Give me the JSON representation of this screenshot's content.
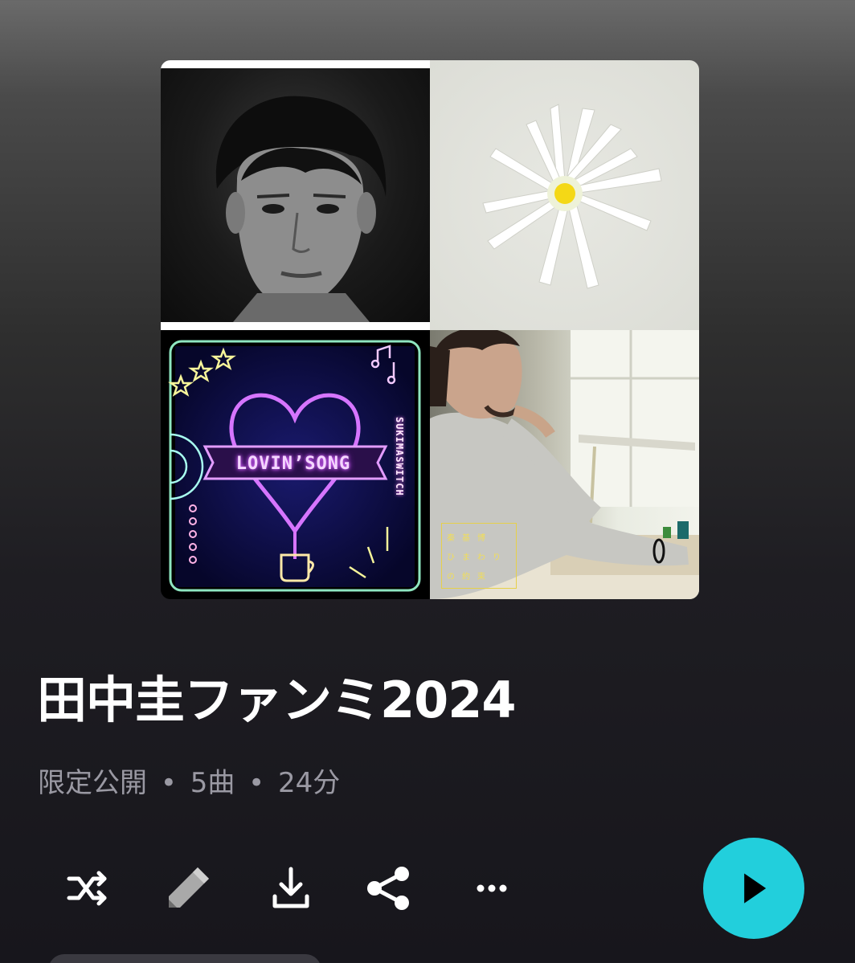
{
  "playlist": {
    "title": "田中圭ファンミ2024",
    "visibility": "限定公開",
    "separator": "•",
    "track_count": "5曲",
    "duration": "24分"
  },
  "artwork": {
    "tile3": {
      "title": "LOVIN’SONG",
      "artist": "SUKIMASWITCH"
    },
    "tile4": {
      "lines": [
        "秦基博",
        "ひまわり",
        "の約束"
      ]
    }
  },
  "actions": {
    "shuffle": "shuffle-icon",
    "edit": "pencil-icon",
    "download": "download-icon",
    "share": "share-icon",
    "more": "more-icon",
    "play": "play-icon"
  },
  "colors": {
    "accent": "#22cfdc",
    "meta_text": "#9a99a3",
    "title_text": "#ffffff"
  }
}
